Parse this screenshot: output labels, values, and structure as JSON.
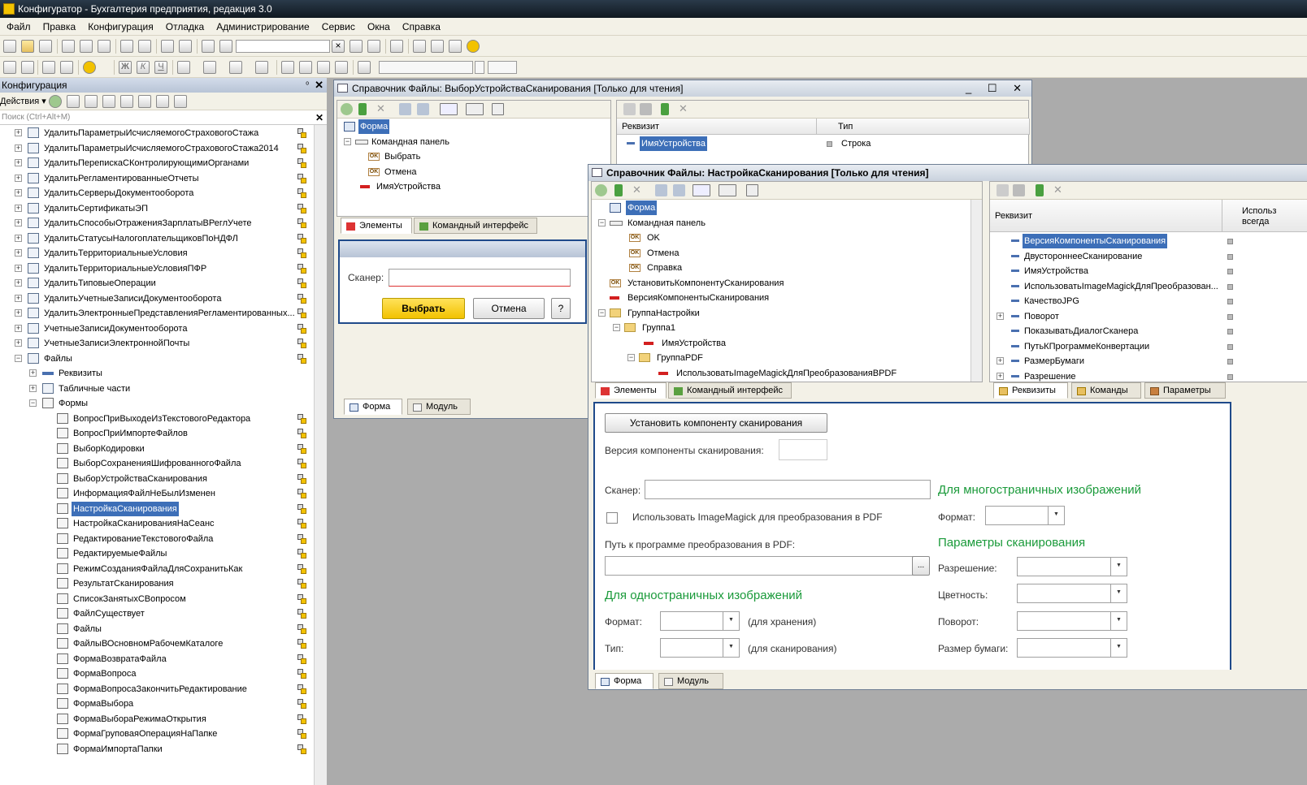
{
  "window": {
    "title": "Конфигуратор - Бухгалтерия предприятия, редакция 3.0"
  },
  "menu": [
    "Файл",
    "Правка",
    "Конфигурация",
    "Отладка",
    "Администрирование",
    "Сервис",
    "Окна",
    "Справка"
  ],
  "config_panel": {
    "title": "Конфигурация",
    "actions_label": "Действия ▾",
    "search_placeholder": "Поиск (Ctrl+Alt+M)",
    "tree": [
      {
        "label": "УдалитьПараметрыИсчисляемогоСтраховогоСтажа",
        "level": 1,
        "type": "catalog",
        "exp": "+",
        "lock": true
      },
      {
        "label": "УдалитьПараметрыИсчисляемогоСтраховогоСтажа2014",
        "level": 1,
        "type": "catalog",
        "exp": "+",
        "lock": true
      },
      {
        "label": "УдалитьПерепискаСКонтролирующимиОрганами",
        "level": 1,
        "type": "catalog",
        "exp": "+",
        "lock": true
      },
      {
        "label": "УдалитьРегламентированныеОтчеты",
        "level": 1,
        "type": "catalog",
        "exp": "+",
        "lock": true
      },
      {
        "label": "УдалитьСерверыДокументооборота",
        "level": 1,
        "type": "catalog",
        "exp": "+",
        "lock": true
      },
      {
        "label": "УдалитьСертификатыЭП",
        "level": 1,
        "type": "catalog",
        "exp": "+",
        "lock": true
      },
      {
        "label": "УдалитьСпособыОтраженияЗарплатыВРеглУчете",
        "level": 1,
        "type": "catalog",
        "exp": "+",
        "lock": true
      },
      {
        "label": "УдалитьСтатусыНалогоплательщиковПоНДФЛ",
        "level": 1,
        "type": "catalog",
        "exp": "+",
        "lock": true
      },
      {
        "label": "УдалитьТерриториальныеУсловия",
        "level": 1,
        "type": "catalog",
        "exp": "+",
        "lock": true
      },
      {
        "label": "УдалитьТерриториальныеУсловияПФР",
        "level": 1,
        "type": "catalog",
        "exp": "+",
        "lock": true
      },
      {
        "label": "УдалитьТиповыеОперации",
        "level": 1,
        "type": "catalog",
        "exp": "+",
        "lock": true
      },
      {
        "label": "УдалитьУчетныеЗаписиДокументооборота",
        "level": 1,
        "type": "catalog",
        "exp": "+",
        "lock": true
      },
      {
        "label": "УдалитьЭлектронныеПредставленияРегламентированных...",
        "level": 1,
        "type": "catalog",
        "exp": "+",
        "lock": true
      },
      {
        "label": "УчетныеЗаписиДокументооборота",
        "level": 1,
        "type": "catalog",
        "exp": "+",
        "lock": true
      },
      {
        "label": "УчетныеЗаписиЭлектроннойПочты",
        "level": 1,
        "type": "catalog",
        "exp": "+",
        "lock": true
      },
      {
        "label": "Файлы",
        "level": 1,
        "type": "catalog",
        "exp": "−",
        "lock": true
      },
      {
        "label": "Реквизиты",
        "level": 2,
        "type": "attr",
        "exp": "+",
        "lock": false
      },
      {
        "label": "Табличные части",
        "level": 2,
        "type": "catalog",
        "exp": "+",
        "lock": false
      },
      {
        "label": "Формы",
        "level": 2,
        "type": "form",
        "exp": "−",
        "lock": false
      },
      {
        "label": "ВопросПриВыходеИзТекстовогоРедактора",
        "level": 3,
        "type": "form",
        "exp": "",
        "lock": true
      },
      {
        "label": "ВопросПриИмпортеФайлов",
        "level": 3,
        "type": "form",
        "exp": "",
        "lock": true
      },
      {
        "label": "ВыборКодировки",
        "level": 3,
        "type": "form",
        "exp": "",
        "lock": true
      },
      {
        "label": "ВыборСохраненияШифрованногоФайла",
        "level": 3,
        "type": "form",
        "exp": "",
        "lock": true
      },
      {
        "label": "ВыборУстройстваСканирования",
        "level": 3,
        "type": "form",
        "exp": "",
        "lock": true
      },
      {
        "label": "ИнформацияФайлНеБылИзменен",
        "level": 3,
        "type": "form",
        "exp": "",
        "lock": true
      },
      {
        "label": "НастройкаСканирования",
        "level": 3,
        "type": "form",
        "exp": "",
        "lock": true,
        "selected": true
      },
      {
        "label": "НастройкаСканированияНаСеанс",
        "level": 3,
        "type": "form",
        "exp": "",
        "lock": true
      },
      {
        "label": "РедактированиеТекстовогоФайла",
        "level": 3,
        "type": "form",
        "exp": "",
        "lock": true
      },
      {
        "label": "РедактируемыеФайлы",
        "level": 3,
        "type": "form",
        "exp": "",
        "lock": true
      },
      {
        "label": "РежимСозданияФайлаДляСохранитьКак",
        "level": 3,
        "type": "form",
        "exp": "",
        "lock": true
      },
      {
        "label": "РезультатСканирования",
        "level": 3,
        "type": "form",
        "exp": "",
        "lock": true
      },
      {
        "label": "СписокЗанятыхСВопросом",
        "level": 3,
        "type": "form",
        "exp": "",
        "lock": true
      },
      {
        "label": "ФайлСуществует",
        "level": 3,
        "type": "form",
        "exp": "",
        "lock": true
      },
      {
        "label": "Файлы",
        "level": 3,
        "type": "form",
        "exp": "",
        "lock": true
      },
      {
        "label": "ФайлыВОсновномРабочемКаталоге",
        "level": 3,
        "type": "form",
        "exp": "",
        "lock": true
      },
      {
        "label": "ФормаВозвратаФайла",
        "level": 3,
        "type": "form",
        "exp": "",
        "lock": true
      },
      {
        "label": "ФормаВопроса",
        "level": 3,
        "type": "form",
        "exp": "",
        "lock": true
      },
      {
        "label": "ФормаВопросаЗакончитьРедактирование",
        "level": 3,
        "type": "form",
        "exp": "",
        "lock": true
      },
      {
        "label": "ФормаВыбора",
        "level": 3,
        "type": "form",
        "exp": "",
        "lock": true
      },
      {
        "label": "ФормаВыбораРежимаОткрытия",
        "level": 3,
        "type": "form",
        "exp": "",
        "lock": true
      },
      {
        "label": "ФормаГруповаяОперацияНаПапке",
        "level": 3,
        "type": "form",
        "exp": "",
        "lock": true
      },
      {
        "label": "ФормаИмпортаПапки",
        "level": 3,
        "type": "form",
        "exp": "",
        "lock": true
      }
    ]
  },
  "win1": {
    "title": "Справочник Файлы: ВыборУстройстваСканирования [Только для чтения]",
    "elements": [
      {
        "label": "Форма",
        "type": "form",
        "exp": "",
        "selected": true
      },
      {
        "label": "Командная панель",
        "type": "cmd",
        "exp": "−"
      },
      {
        "label": "Выбрать",
        "type": "ok",
        "exp": ""
      },
      {
        "label": "Отмена",
        "type": "ok",
        "exp": ""
      },
      {
        "label": "ИмяУстройства",
        "type": "field",
        "exp": ""
      }
    ],
    "attr_head": "Реквизит",
    "type_head": "Тип",
    "attr_row": {
      "name": "ИмяУстройства",
      "type": "Строка"
    },
    "tab_elements": "Элементы",
    "tab_cmd_interface": "Командный интерфейс",
    "preview": {
      "label": "Сканер:",
      "btn_select": "Выбрать",
      "btn_cancel": "Отмена",
      "btn_help": "?"
    },
    "tab_form": "Форма",
    "tab_module": "Модуль"
  },
  "win2": {
    "title": "Справочник Файлы: НастройкаСканирования [Только для чтения]",
    "elements": [
      {
        "label": "Форма",
        "type": "form",
        "level": 0,
        "exp": "",
        "selected": true
      },
      {
        "label": "Командная панель",
        "type": "cmd",
        "level": 0,
        "exp": "−"
      },
      {
        "label": "OK",
        "type": "ok",
        "level": 1,
        "exp": ""
      },
      {
        "label": "Отмена",
        "type": "ok",
        "level": 1,
        "exp": ""
      },
      {
        "label": "Справка",
        "type": "ok",
        "level": 1,
        "exp": ""
      },
      {
        "label": "УстановитьКомпонентуСканирования",
        "type": "ok",
        "level": 0,
        "exp": ""
      },
      {
        "label": "ВерсияКомпонентыСканирования",
        "type": "field",
        "level": 0,
        "exp": ""
      },
      {
        "label": "ГруппаНастройки",
        "type": "folder",
        "level": 0,
        "exp": "−"
      },
      {
        "label": "Группа1",
        "type": "folder",
        "level": 1,
        "exp": "−"
      },
      {
        "label": "ИмяУстройства",
        "type": "field",
        "level": 2,
        "exp": ""
      },
      {
        "label": "ГруппаPDF",
        "type": "folder",
        "level": 2,
        "exp": "−"
      },
      {
        "label": "ИспользоватьImageMagickДляПреобразованияВPDF",
        "type": "field",
        "level": 3,
        "exp": ""
      }
    ],
    "attr_head": "Реквизит",
    "use_head": "Использ\nвсегда",
    "attrs": [
      {
        "label": "ВерсияКомпонентыСканирования",
        "exp": "",
        "selected": true
      },
      {
        "label": "ДвустороннееСканирование",
        "exp": ""
      },
      {
        "label": "ИмяУстройства",
        "exp": ""
      },
      {
        "label": "ИспользоватьImageMagickДляПреобразован...",
        "exp": ""
      },
      {
        "label": "КачествоJPG",
        "exp": ""
      },
      {
        "label": "Поворот",
        "exp": "+"
      },
      {
        "label": "ПоказыватьДиалогСканера",
        "exp": ""
      },
      {
        "label": "ПутьКПрограммеКонвертации",
        "exp": ""
      },
      {
        "label": "РазмерБумаги",
        "exp": "+"
      },
      {
        "label": "Разрешение",
        "exp": "+"
      }
    ],
    "tab_elements": "Элементы",
    "tab_cmd_interface": "Командный интерфейс",
    "tab_attrs": "Реквизиты",
    "tab_commands": "Команды",
    "tab_params": "Параметры",
    "preview": {
      "install_btn": "Установить компоненту сканирования",
      "version_label": "Версия компоненты сканирования:",
      "scanner_label": "Сканер:",
      "use_im_label": "Использовать ImageMagick для преобразования в PDF",
      "path_label": "Путь к программе преобразования в PDF:",
      "path_btn": "...",
      "single_group": "Для одностраничных изображений",
      "format_label": "Формат:",
      "format_hint": "(для хранения)",
      "type_label": "Тип:",
      "type_hint": "(для сканирования)",
      "multi_group": "Для многостраничных изображений",
      "multi_format_label": "Формат:",
      "scan_params_group": "Параметры сканирования",
      "resolution_label": "Разрешение:",
      "color_label": "Цветность:",
      "rotate_label": "Поворот:",
      "paper_label": "Размер бумаги:"
    },
    "tab_form": "Форма",
    "tab_module": "Модуль"
  }
}
